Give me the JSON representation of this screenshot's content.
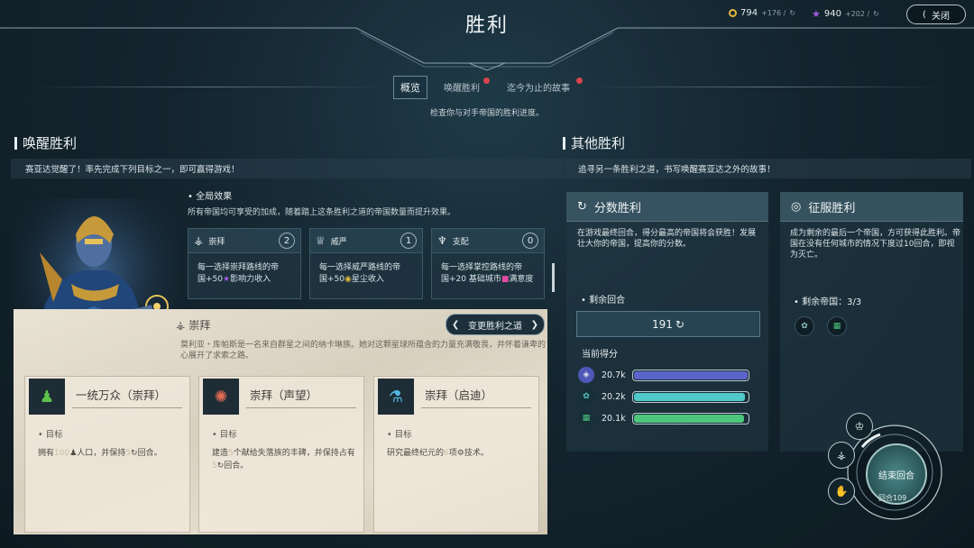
{
  "header": {
    "title": "胜利",
    "resources": [
      {
        "icon": "influence-coin-icon",
        "color": "#e2b73b",
        "value": "794",
        "delta": "+176 /"
      },
      {
        "icon": "star-icon",
        "color": "#a45be0",
        "value": "940",
        "delta": "+202 /"
      }
    ],
    "close_label": "关闭",
    "tabs": [
      {
        "label": "概览",
        "active": true
      },
      {
        "label": "唤醒胜利",
        "alert": true
      },
      {
        "label": "迄今为止的故事",
        "alert": true
      }
    ],
    "subtitle": "检查你与对手帝国的胜利进度。"
  },
  "awakening": {
    "title": "唤醒胜利",
    "banner": "赛亚达觉醒了！率先完成下列目标之一，即可赢得游戏！",
    "global_effects_title": "全局效果",
    "global_effects_desc": "所有帝国均可享受的加成，随着踏上这条胜利之道的帝国数量而提升效果。",
    "effects": [
      {
        "name": "崇拜",
        "count": "2",
        "icon": "worship-icon",
        "line1": "每一选择崇拜路线的帝",
        "line2a": "国+50",
        "line2b": "影响力收入"
      },
      {
        "name": "威严",
        "count": "1",
        "icon": "majesty-icon",
        "line1": "每一选择威严路线的帝",
        "line2a": "国+50",
        "line2b": "星尘收入"
      },
      {
        "name": "支配",
        "count": "0",
        "icon": "dominion-icon",
        "line1": "每一选择掌控路线的帝",
        "line2a": "国+20 基础城市",
        "line2b": "满意度"
      }
    ],
    "path_name": "崇拜",
    "change_path_label": "变更胜利之道",
    "path_desc": "莫利亚・库帕斯是一名来自群星之间的纳卡琳族。她对这颗星球所蕴含的力量充满敬畏，并怀着谦卑的心展开了求索之路。",
    "goals": [
      {
        "title": "一统万众（崇拜）",
        "label": "目标",
        "icon": "person-icon",
        "color": "#5ec24a",
        "desc_a": "拥有",
        "desc_n": "100",
        "desc_b": "人口，并保持",
        "desc_n2": "5",
        "desc_c": "回合。"
      },
      {
        "title": "崇拜（声望）",
        "label": "目标",
        "icon": "spiral-icon",
        "color": "#e06a55",
        "desc_a": "建造",
        "desc_n": "5",
        "desc_b": "个献给失落族的丰碑，并保持占有",
        "desc_n2": "5",
        "desc_c": "回合。"
      },
      {
        "title": "崇拜（启迪）",
        "label": "目标",
        "icon": "flask-icon",
        "color": "#4fb6e0",
        "desc_a": "研究最终纪元的",
        "desc_n": "6",
        "desc_b": "项",
        "desc_n2": "",
        "desc_c": "技术。"
      }
    ]
  },
  "other": {
    "title": "其他胜利",
    "banner": "追寻另一条胜利之道，书写唤醒赛亚达之外的故事！",
    "score": {
      "title": "分数胜利",
      "desc": "在游戏最终回合，得分最高的帝国将会获胜！发展壮大你的帝国，提高你的分数。",
      "rounds_label": "剩余回合",
      "rounds_value": "191",
      "current_label": "当前得分",
      "rows": [
        {
          "value": "20.7k",
          "fraction": 1.0,
          "color": "#5a64c8",
          "icon": "empire-emblem-icon"
        },
        {
          "value": "20.2k",
          "fraction": 0.976,
          "color": "#4fc9c9",
          "icon": "empire-emblem-icon"
        },
        {
          "value": "20.1k",
          "fraction": 0.971,
          "color": "#4dc67d",
          "icon": "empire-emblem-icon"
        }
      ]
    },
    "conquest": {
      "title": "征服胜利",
      "desc": "成为剩余的最后一个帝国，方可获得此胜利。帝国在没有任何城市的情况下度过10回合，即视为灭亡。",
      "remaining_label": "剩余帝国：3/3"
    }
  },
  "end_turn": {
    "label": "结束回合",
    "turn": "回合109"
  }
}
